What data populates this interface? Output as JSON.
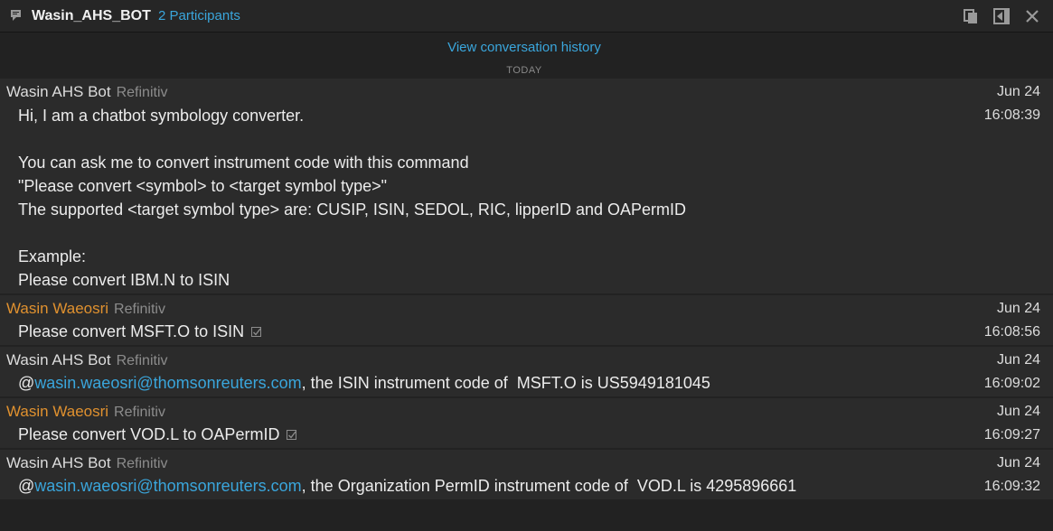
{
  "header": {
    "title": "Wasin_AHS_BOT",
    "participants": "2 Participants"
  },
  "history_link": "View conversation history",
  "day_label": "TODAY",
  "messages": [
    {
      "sender": "Wasin AHS Bot",
      "org": "Refinitiv",
      "date": "Jun 24",
      "time": "16:08:39",
      "lines": [
        "Hi, I am a chatbot symbology converter.",
        "You can ask me to convert instrument code with this command",
        "\"Please convert <symbol> to <target symbol type>\"",
        "The supported <target symbol type> are: CUSIP, ISIN, SEDOL, RIC, lipperID and OAPermID",
        "Example:",
        "Please convert IBM.N to ISIN"
      ]
    },
    {
      "sender": "Wasin Waeosri",
      "org": "Refinitiv",
      "date": "Jun 24",
      "time": "16:08:56",
      "text": "Please convert MSFT.O to ISIN"
    },
    {
      "sender": "Wasin AHS Bot",
      "org": "Refinitiv",
      "date": "Jun 24",
      "time": "16:09:02",
      "prefix": "@",
      "mention": "wasin.waeosri@thomsonreuters.com",
      "text": ", the ISIN instrument code of  MSFT.O is US5949181045"
    },
    {
      "sender": "Wasin Waeosri",
      "org": "Refinitiv",
      "date": "Jun 24",
      "time": "16:09:27",
      "text": "Please convert VOD.L to OAPermID"
    },
    {
      "sender": "Wasin AHS Bot",
      "org": "Refinitiv",
      "date": "Jun 24",
      "time": "16:09:32",
      "prefix": "@",
      "mention": "wasin.waeosri@thomsonreuters.com",
      "text": ", the Organization PermID instrument code of  VOD.L is 4295896661"
    }
  ],
  "icons": {
    "chat": "chat-bubble-icon",
    "copy": "copy-icon",
    "collapse": "collapse-panel-icon",
    "close": "close-icon",
    "delivered": "delivered-check-icon"
  },
  "colors": {
    "background": "#222222",
    "message_bg": "#2b2b2b",
    "link": "#3aa6dc",
    "user_name": "#e0912f"
  }
}
